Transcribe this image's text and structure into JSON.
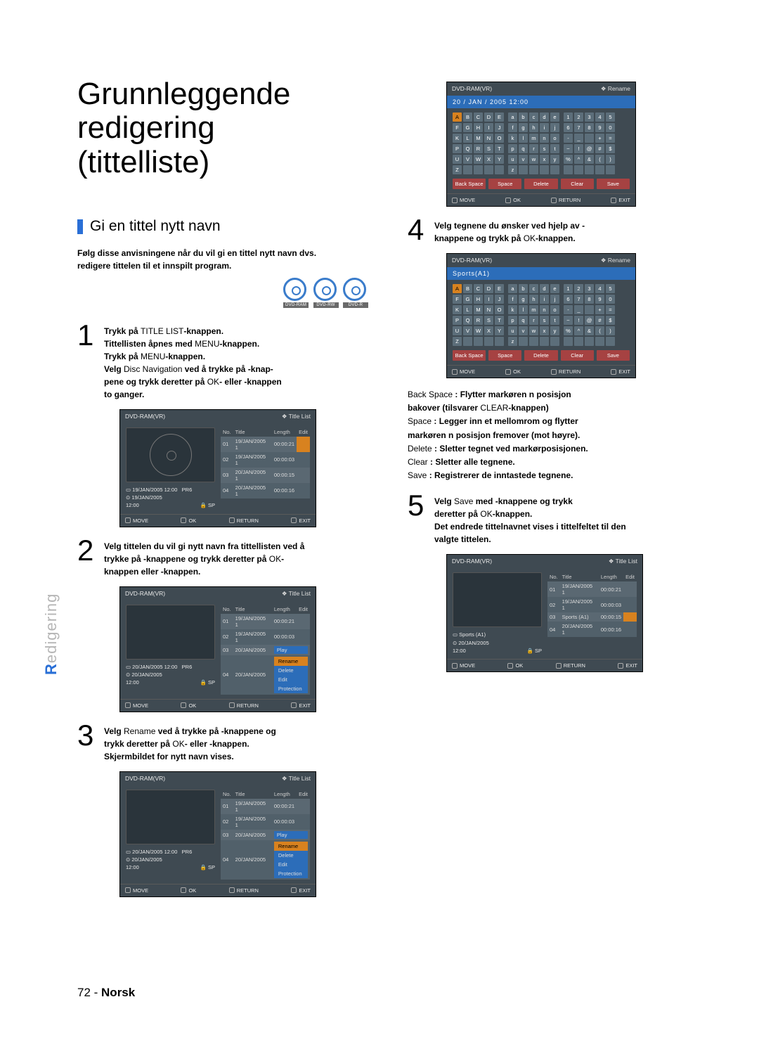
{
  "main_title": "Grunnleggende redigering (tittelliste)",
  "section_heading": "Gi en tittel nytt navn",
  "intro": "Følg disse anvisningene når du vil gi en tittel nytt navn dvs. redigere tittelen til et innspilt program.",
  "disc_labels": [
    "DVD-RAM",
    "DVD-RW",
    "DVD-R"
  ],
  "steps": {
    "s1": {
      "l1a": "Trykk på ",
      "l1b": "TITLE LIST",
      "l1c": "-knappen.",
      "l2a": "Tittellisten åpnes med ",
      "l2b": "MENU",
      "l2c": "-knappen.",
      "l3a": "Trykk på ",
      "l3b": "MENU",
      "l3c": "-knappen.",
      "l4a": "Velg ",
      "l4b": "Disc Navigation",
      "l4c": " ved å trykke på        -knap-",
      "l5": "pene og trykk deretter på ",
      "l5b": "OK",
      "l5c": "- eller      -knappen",
      "l6": "to ganger."
    },
    "s2": {
      "l1": "Velg tittelen du vil gi nytt navn fra tittellisten ved å",
      "l2a": "trykke på        -knappene og trykk deretter på ",
      "l2b": "OK",
      "l2c": "-",
      "l3": "knappen eller      -knappen."
    },
    "s3": {
      "l1a": "Velg ",
      "l1b": "Rename",
      "l1c": " ved å trykke på        -knappene og",
      "l2a": "trykk deretter på ",
      "l2b": "OK",
      "l2c": "- eller      -knappen.",
      "l3": "Skjermbildet for nytt navn vises."
    },
    "s4": {
      "l1": "Velg tegnene du ønsker ved hjelp av                     -",
      "l2a": "knappene og trykk på ",
      "l2b": "OK",
      "l2c": "-knappen."
    },
    "s5": {
      "l1a": "Velg ",
      "l1b": "Save",
      "l1c": " med              -knappene og trykk",
      "l2a": "deretter på ",
      "l2b": "OK",
      "l2c": "-knappen.",
      "l3": "Det endrede tittelnavnet vises i tittelfeltet til den",
      "l4": "valgte tittelen."
    }
  },
  "defs": {
    "bs_t": "Back Space",
    "bs": ": Flytter markøren n posisjon",
    "bs2": "bakover (tilsvarer ",
    "bs2t": "CLEAR",
    "bs2c": "-knappen)",
    "sp_t": "Space",
    "sp": ": Legger inn et mellomrom og flytter",
    "sp2": "markøren n posisjon fremover (mot høyre).",
    "de_t": "Delete",
    "de": ": Sletter tegnet ved markørposisjonen.",
    "cl_t": "Clear",
    "cl": ": Sletter alle tegnene.",
    "sv_t": "Save",
    "sv": ": Registrerer de inntastede tegnene."
  },
  "osd": {
    "hdr_left": "DVD-RAM(VR)",
    "title_list": "Title List",
    "rename": "Rename",
    "ftr_move": "MOVE",
    "ftr_ok": "OK",
    "ftr_return": "RETURN",
    "ftr_exit": "EXIT",
    "cols": {
      "no": "No.",
      "title": "Title",
      "length": "Length",
      "edit": "Edit"
    },
    "rows1": [
      {
        "no": "01",
        "title": "19/JAN/2005 1",
        "len": "00:00:21"
      },
      {
        "no": "02",
        "title": "19/JAN/2005 1",
        "len": "00:00:03"
      },
      {
        "no": "03",
        "title": "20/JAN/2005 1",
        "len": "00:00:15"
      },
      {
        "no": "04",
        "title": "20/JAN/2005 1",
        "len": "00:00:16"
      }
    ],
    "meta1": {
      "d": "19/JAN/2005 12:00",
      "p": "PR6",
      "r": "19/JAN/2005",
      "t": "12:00",
      "sp": "SP"
    },
    "meta2": {
      "d": "20/JAN/2005 12:00",
      "p": "PR6",
      "r": "20/JAN/2005",
      "t": "12:00",
      "sp": "SP"
    },
    "menu": [
      "Rename",
      "Delete",
      "Edit",
      "Protection"
    ],
    "menu_pre": [
      "Play"
    ],
    "kbd_date": "20 / JAN / 2005 12:00",
    "kbd_text": "Sports(A1)",
    "kbd_U": [
      [
        "A",
        "B",
        "C",
        "D",
        "E"
      ],
      [
        "F",
        "G",
        "H",
        "I",
        "J"
      ],
      [
        "K",
        "L",
        "M",
        "N",
        "O"
      ],
      [
        "P",
        "Q",
        "R",
        "S",
        "T"
      ],
      [
        "U",
        "V",
        "W",
        "X",
        "Y"
      ],
      [
        "Z",
        "",
        "",
        "",
        ""
      ]
    ],
    "kbd_l": [
      [
        "a",
        "b",
        "c",
        "d",
        "e"
      ],
      [
        "f",
        "g",
        "h",
        "i",
        "j"
      ],
      [
        "k",
        "l",
        "m",
        "n",
        "o"
      ],
      [
        "p",
        "q",
        "r",
        "s",
        "t"
      ],
      [
        "u",
        "v",
        "w",
        "x",
        "y"
      ],
      [
        "z",
        "",
        "",
        "",
        ""
      ]
    ],
    "kbd_n": [
      [
        "1",
        "2",
        "3",
        "4",
        "5"
      ],
      [
        "6",
        "7",
        "8",
        "9",
        "0"
      ],
      [
        "-",
        "_",
        " ",
        "+",
        "="
      ],
      [
        "~",
        "!",
        "@",
        "#",
        "$"
      ],
      [
        "%",
        "^",
        "&",
        "(",
        ")"
      ],
      [
        "",
        "",
        "",
        "",
        ""
      ]
    ],
    "actions": [
      "Back Space",
      "Space",
      "Delete",
      "Clear",
      "Save"
    ],
    "rows5": [
      {
        "no": "01",
        "title": "19/JAN/2005 1",
        "len": "00:00:21"
      },
      {
        "no": "02",
        "title": "19/JAN/2005 1",
        "len": "00:00:03"
      },
      {
        "no": "03",
        "title": "Sports (A1)",
        "len": "00:00:15"
      },
      {
        "no": "04",
        "title": "20/JAN/2005 1",
        "len": "00:00:16"
      }
    ],
    "meta5": {
      "d": "Sports (A1)",
      "r": "20/JAN/2005",
      "t": "12:00",
      "sp": "SP"
    }
  },
  "sidebar": {
    "r": "R",
    "rest": "edigering"
  },
  "footer": {
    "page": "72 -",
    "lang": "Norsk"
  }
}
